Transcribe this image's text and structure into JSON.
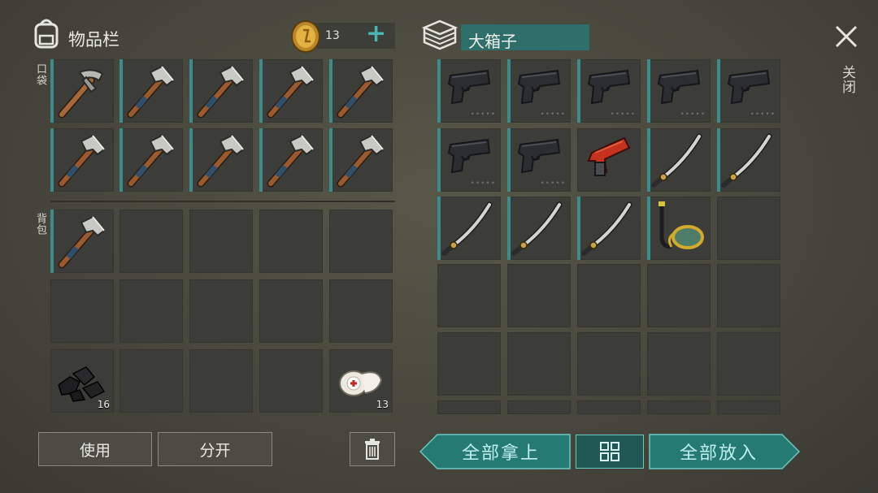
{
  "inventory": {
    "title": "物品栏",
    "coins": "13",
    "add_symbol": "+",
    "pocket_label": "口袋",
    "backpack_label": "背包",
    "charcoal_count": "16",
    "bandage_count": "13"
  },
  "container": {
    "name": "大箱子",
    "close_label": "关闭",
    "pistol_ammo": "•••••"
  },
  "buttons": {
    "use": "使用",
    "split": "分开",
    "take_all": "全部拿上",
    "put_all": "全部放入"
  },
  "colors": {
    "accent": "#3b8c8a",
    "teal_button": "#257a74",
    "slot_bg": "#3c3d38"
  }
}
